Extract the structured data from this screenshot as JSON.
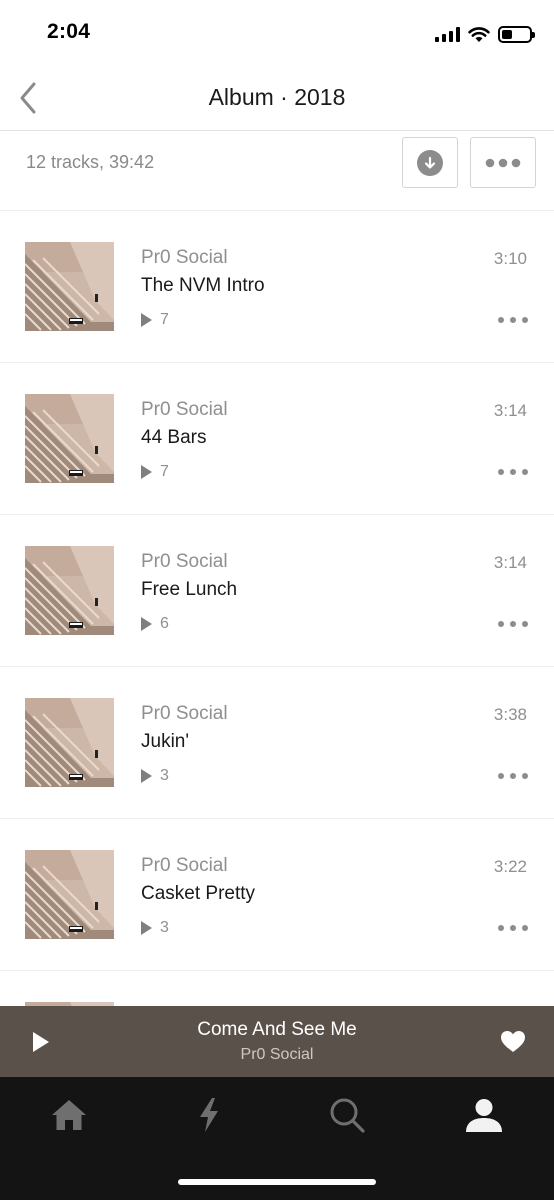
{
  "status_bar": {
    "time": "2:04",
    "signal_icon": "cellular-signal-icon",
    "wifi_icon": "wifi-icon",
    "battery_icon": "battery-icon",
    "battery_level": 0.4
  },
  "header": {
    "back_icon": "chevron-left-icon",
    "title": "Album · 2018"
  },
  "album_info": {
    "summary": "12 tracks, 39:42",
    "download_icon": "download-icon",
    "more_icon": "more-horizontal-icon"
  },
  "tracks": [
    {
      "artist": "Pr0 Social",
      "title": "The NVM Intro",
      "plays": "7",
      "duration": "3:10"
    },
    {
      "artist": "Pr0 Social",
      "title": "44 Bars",
      "plays": "7",
      "duration": "3:14"
    },
    {
      "artist": "Pr0 Social",
      "title": "Free Lunch",
      "plays": "6",
      "duration": "3:14"
    },
    {
      "artist": "Pr0 Social",
      "title": "Jukin'",
      "plays": "3",
      "duration": "3:38"
    },
    {
      "artist": "Pr0 Social",
      "title": "Casket Pretty",
      "plays": "3",
      "duration": "3:22"
    }
  ],
  "now_playing": {
    "title": "Come And See Me",
    "artist": "Pr0 Social",
    "play_icon": "play-icon",
    "heart_icon": "heart-icon"
  },
  "tab_bar": {
    "tabs": [
      {
        "icon": "home-icon",
        "selected": false
      },
      {
        "icon": "lightning-bolt-icon",
        "selected": false
      },
      {
        "icon": "search-icon",
        "selected": false
      },
      {
        "icon": "profile-icon",
        "selected": true
      }
    ]
  },
  "colors": {
    "mini_player_bg": "#5a514b",
    "tab_bar_bg": "#141414",
    "secondary_text": "#8f8f8f"
  }
}
